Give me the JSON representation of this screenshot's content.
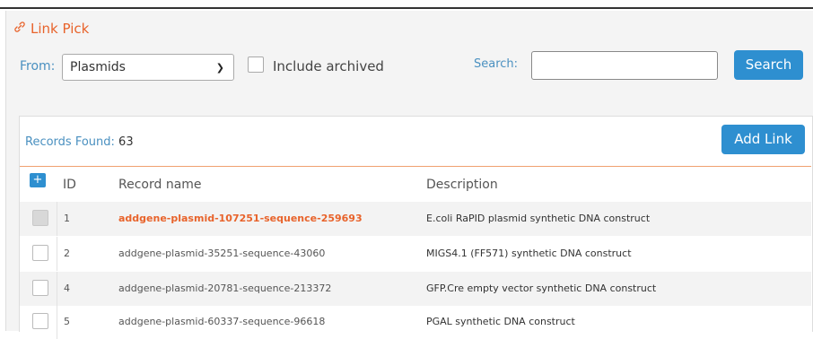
{
  "header": {
    "title": "Link Pick",
    "title_icon": "link-icon"
  },
  "filters": {
    "from_label": "From:",
    "from_value": "Plasmids",
    "include_archived_label": "Include archived",
    "search_label": "Search:",
    "search_value": "",
    "search_button": "Search"
  },
  "records": {
    "found_label": "Records Found:",
    "found_count": "63",
    "add_link_button": "Add Link"
  },
  "table": {
    "expand_symbol": "+",
    "columns": [
      "ID",
      "Record name",
      "Description"
    ],
    "rows": [
      {
        "id": "1",
        "name": "addgene-plasmid-107251-sequence-259693",
        "description": "E.coli RaPID plasmid synthetic DNA construct"
      },
      {
        "id": "2",
        "name": "addgene-plasmid-35251-sequence-43060",
        "description": "MIGS4.1 (FF571) synthetic DNA construct"
      },
      {
        "id": "4",
        "name": "addgene-plasmid-20781-sequence-213372",
        "description": "GFP.Cre empty vector synthetic DNA construct"
      },
      {
        "id": "5",
        "name": "addgene-plasmid-60337-sequence-96618",
        "description": "PGAL synthetic DNA construct"
      }
    ]
  },
  "colors": {
    "accent": "#e8632b",
    "primary": "#2e8fd0",
    "label_blue": "#4a90c0"
  }
}
